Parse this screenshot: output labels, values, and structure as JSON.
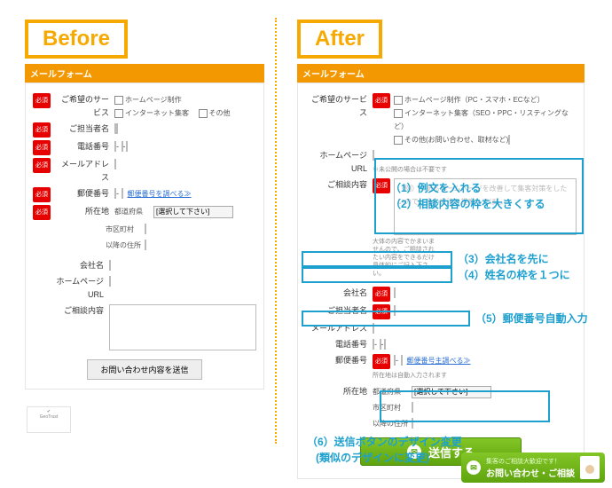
{
  "heading_before": "Before",
  "heading_after": "After",
  "form_title": "メールフォーム",
  "labels": {
    "required": "必須",
    "service": "ご希望のサービス",
    "name": "ご担当者名",
    "tel": "電話番号",
    "mail": "メールアドレス",
    "zip": "郵便番号",
    "address": "所在地",
    "pref": "都道府県",
    "city": "市区町村",
    "rest": "以降の住所",
    "company": "会社名",
    "url": "ホームページURL",
    "inquiry": "ご相談内容",
    "url_note": "※未公開の場合は不要です",
    "inquiry_note": "大体の内容でかまいませんので、ご相談されたい内容をできるだけ具体的にご記入下さい。"
  },
  "before_options": [
    "ホームページ制作",
    "インターネット集客",
    "その他"
  ],
  "after_options": [
    "ホームページ制作（PC・スマホ・ECなど）",
    "インターネット集客（SEO・PPC・リスティングなど）",
    "その他(お問い合わせ、取材など)"
  ],
  "select_placeholder": "[選択して下さい]",
  "zip_link": "郵便番号を調べる≫",
  "zip_link_after": "郵便番号主調べる≫",
  "inquiry_placeholder": "（例）今あるホームページを改善して集客対策をしたいので、良い方法を提案してほしい",
  "submit_gray": "お問い合わせ内容を送信",
  "submit_green": "送信する",
  "annotations": {
    "a1": "（1）例文を入れる",
    "a2": "（2）相談内容の枠を大きくする",
    "a3": "（3）会社名を先に",
    "a4": "（4）姓名の枠を１つに",
    "a5": "（5）郵便番号自動入力",
    "a6a": "（6）送信ボタンのデザイン変更",
    "a6b": "(類似のデザインに変更)"
  },
  "contact": {
    "sub": "集客のご相談大歓迎です！",
    "main": "お問い合わせ・ご相談"
  },
  "seal": "GeoTrust"
}
